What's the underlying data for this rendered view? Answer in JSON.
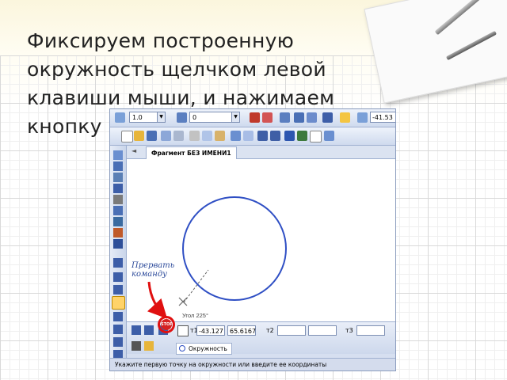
{
  "slide": {
    "text": "Фиксируем построенную окружность щелчком левой клавиши мыши, и нажимаем кнопку"
  },
  "toolbar": {
    "scale_value": "1.0",
    "layer_value": "0",
    "coord_x": "-41.53"
  },
  "document": {
    "tab_title": "Фрагмент БЕЗ ИМЕНИ1",
    "angle_label": "Угол 225°"
  },
  "properties": {
    "t1_label": "т1",
    "x_value": "-43.127",
    "y_value": "65.6167",
    "t2_label": "т2",
    "t3_label": "т3",
    "object_tab": "Окружность"
  },
  "status_bar": {
    "text": "Укажите первую точку на окружности или введите ее координаты"
  },
  "annotation": {
    "line1": "Прервать",
    "line2": "команду"
  },
  "colors": {
    "circle": "#2f4fc4",
    "highlight": "#e01010",
    "annotation": "#2c4a9a"
  }
}
